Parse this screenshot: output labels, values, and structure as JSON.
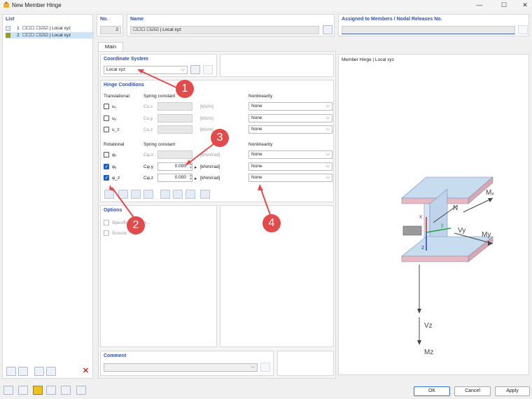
{
  "window": {
    "title": "New Member Hinge",
    "minimize": "—",
    "maximize": "☐",
    "close": "✕"
  },
  "list": {
    "title": "List",
    "items": [
      {
        "num": "1",
        "label": "☐☐☐ ☐☑☑ | Local xyz",
        "color": "#e8f2fa"
      },
      {
        "num": "2",
        "label": "☐☐☐ ☐☑☑ | Local xyz",
        "color": "#9a9a2a"
      }
    ]
  },
  "header": {
    "no_label": "No.",
    "no_value": "2",
    "name_label": "Name",
    "name_value": "☐☐☐ ☐☑☑ | Local xyz",
    "assigned_label": "Assigned to Members / Nodal Releases No."
  },
  "tab": "Main",
  "coordinate_system": {
    "title": "Coordinate System",
    "value": "Local xyz"
  },
  "hinge": {
    "title": "Hinge Conditions",
    "trans_title": "Translational",
    "rot_title": "Rotational",
    "spring_constant": "Spring constant",
    "nonlinearity": "Nonlinearity",
    "rows": [
      {
        "dof": "uₓ",
        "sym": "Cu,x",
        "value": "",
        "unit": "[kN/m]",
        "checked": false,
        "nonlin": "None"
      },
      {
        "dof": "uᵧ",
        "sym": "Cu,y",
        "value": "",
        "unit": "[kN/m]",
        "checked": false,
        "nonlin": "None"
      },
      {
        "dof": "u_z",
        "sym": "Cu,z",
        "value": "",
        "unit": "[kN/m]",
        "checked": false,
        "nonlin": "None"
      },
      {
        "dof": "φₓ",
        "sym": "Cφ,x",
        "value": "",
        "unit": "[kNm/rad]",
        "checked": false,
        "nonlin": "None"
      },
      {
        "dof": "φᵧ",
        "sym": "Cφ,y",
        "value": "0.000",
        "unit": "[kNm/rad]",
        "checked": true,
        "nonlin": "None"
      },
      {
        "dof": "φ_z",
        "sym": "Cφ,z",
        "value": "0.000",
        "unit": "[kNm/rad]",
        "checked": true,
        "nonlin": "None"
      }
    ]
  },
  "options": {
    "title": "Options",
    "items": [
      "Specific direction...",
      "Scissor"
    ]
  },
  "comment": {
    "title": "Comment"
  },
  "preview": {
    "title": "Member Hinge | Local xyz",
    "labels": {
      "mx": "Mₓ",
      "n": "N",
      "vy": "Vy",
      "my": "My",
      "vz": "Vz",
      "mz": "Mz",
      "x": "x",
      "y": "y",
      "z": "z"
    }
  },
  "callouts": [
    "1",
    "2",
    "3",
    "4"
  ],
  "footer": {
    "ok": "OK",
    "cancel": "Cancel",
    "apply": "Apply"
  }
}
